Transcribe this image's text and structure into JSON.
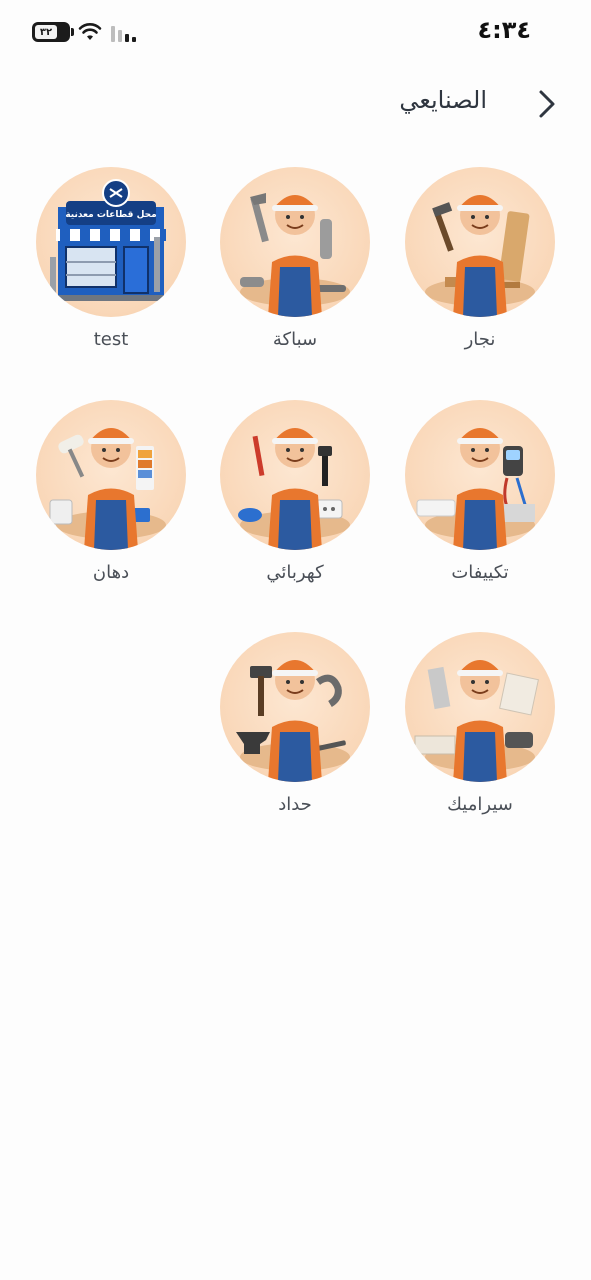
{
  "status_bar": {
    "time": "٤:٣٤",
    "battery": "٣٢",
    "icons": [
      "battery-icon",
      "wifi-icon",
      "signal-icon"
    ]
  },
  "header": {
    "title": "الصنايعي",
    "back_icon": "chevron-right-icon"
  },
  "categories": [
    {
      "label": "نجار",
      "icon": "carpenter-avatar"
    },
    {
      "label": "سباكة",
      "icon": "plumber-avatar"
    },
    {
      "label": "test",
      "icon": "hardware-shop-avatar",
      "shop_sign": "محل قطاعات معدنية"
    },
    {
      "label": "تكييفات",
      "icon": "ac-technician-avatar"
    },
    {
      "label": "كهربائي",
      "icon": "electrician-avatar"
    },
    {
      "label": "دهان",
      "icon": "painter-avatar"
    },
    {
      "label": "سيراميك",
      "icon": "tiler-avatar"
    },
    {
      "label": "حداد",
      "icon": "blacksmith-avatar"
    }
  ],
  "colors": {
    "avatar_bg": "#f9d7b8",
    "overalls": "#2c5aa0",
    "shirt": "#e8772e",
    "cap": "#e8772e",
    "shop_blue": "#1f5fbf"
  }
}
